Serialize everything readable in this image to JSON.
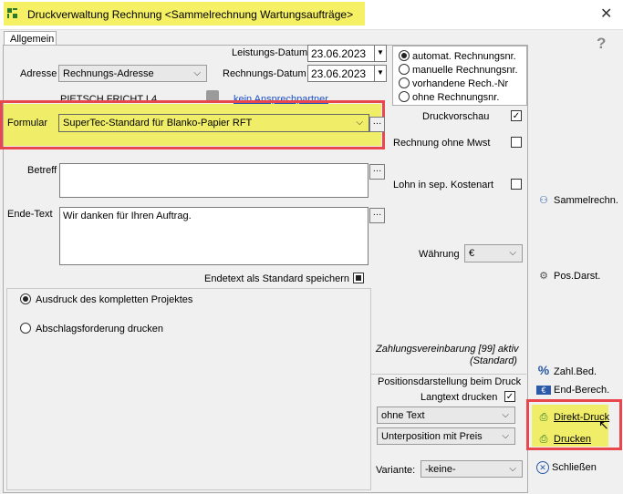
{
  "window": {
    "title": "Druckverwaltung Rechnung <Sammelrechnung Wartungsaufträge>",
    "close": "✕"
  },
  "tab": {
    "label": "Allgemein"
  },
  "header": {
    "leistungs_label": "Leistungs-Datum",
    "leistungs_value": "23.06.2023",
    "rechnungs_label": "Rechnungs-Datum",
    "rechnungs_value": "23.06.2023",
    "adresse_label": "Adresse",
    "adresse_value": "Rechnungs-Adresse",
    "customer_name": "PIETSCH FRICHT L4",
    "contact_link": "kein Ansprechpartner"
  },
  "numbering": {
    "options": [
      "automat. Rechnungsnr.",
      "manuelle Rechnungsnr.",
      "vorhandene Rech.-Nr",
      "ohne Rechnungsnr."
    ],
    "selected_index": 0
  },
  "formular": {
    "label": "Formular",
    "value": "SuperTec-Standard für Blanko-Papier RFT"
  },
  "options": {
    "druckvorschau": "Druckvorschau",
    "ohne_mwst": "Rechnung ohne Mwst",
    "lohn": "Lohn in sep. Kostenart",
    "druckvorschau_checked": true,
    "ohne_mwst_checked": false,
    "lohn_checked": false
  },
  "betreff": {
    "label": "Betreff",
    "value": ""
  },
  "endtext": {
    "label": "Ende-Text",
    "value": "Wir danken für Ihren Auftrag.",
    "save_label": "Endetext als Standard speichern"
  },
  "waehrung": {
    "label": "Währung",
    "value": "€"
  },
  "druck_mode": {
    "options": [
      "Ausdruck des kompletten Projektes",
      "Abschlagsforderung drucken"
    ],
    "selected_index": 0
  },
  "zahlung": {
    "line1": "Zahlungsvereinbarung [99] aktiv",
    "line2": "(Standard)"
  },
  "posdarst": {
    "label": "Positionsdarstellung beim Druck",
    "langtext_label": "Langtext drucken",
    "langtext_checked": true,
    "select1": "ohne Text",
    "select2": "Unterposition mit Preis"
  },
  "variante": {
    "label": "Variante:",
    "value": "-keine-"
  },
  "sidebar": {
    "help": "?",
    "sammel": "Sammelrechn.",
    "posdarst": "Pos.Darst.",
    "zahlbed": "Zahl.Bed.",
    "endberech": "End-Berech.",
    "direktdruck": "Direkt-Druck",
    "drucken": "Drucken",
    "schliessen": "Schließen"
  },
  "colors": {
    "highlight_yellow": "#f0ee68",
    "red_frame": "#e8474e",
    "title_yellow": "#f5f064"
  }
}
